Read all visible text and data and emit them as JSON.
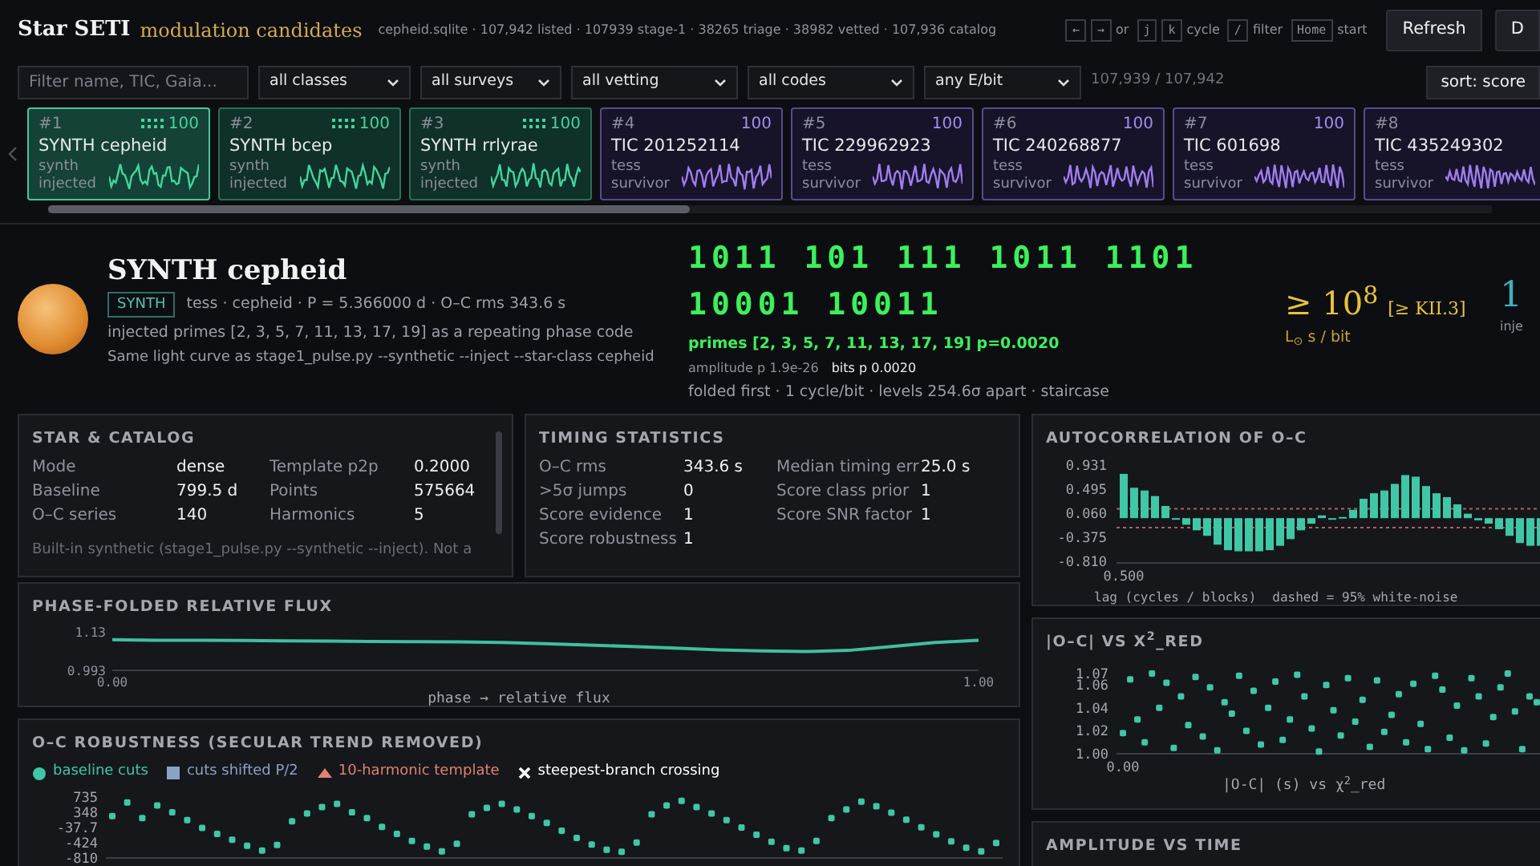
{
  "header": {
    "title": "Star SETI",
    "subtitle": "modulation candidates",
    "stats": "cepheid.sqlite · 107,942 listed · 107939 stage-1 · 38265 triage · 38982 vetted · 107,936 catalog",
    "shortcuts": [
      {
        "kind": "key",
        "text": "←"
      },
      {
        "kind": "key",
        "text": "→"
      },
      {
        "kind": "word",
        "text": "or"
      },
      {
        "kind": "key",
        "text": "j"
      },
      {
        "kind": "key",
        "text": "k"
      },
      {
        "kind": "word",
        "text": "cycle"
      },
      {
        "kind": "key",
        "text": "/"
      },
      {
        "kind": "word",
        "text": "filter"
      },
      {
        "kind": "key",
        "text": "Home"
      },
      {
        "kind": "word",
        "text": "start"
      }
    ],
    "buttons": [
      "Refresh",
      "D"
    ]
  },
  "filters": {
    "search": {
      "placeholder": "Filter name, TIC, Gaia..."
    },
    "selects": [
      "all classes",
      "all surveys",
      "all vetting",
      "all codes",
      "any E/bit"
    ],
    "count": "107,939 / 107,942",
    "sort": "sort: score"
  },
  "candidates": [
    {
      "kind": "synth",
      "number": "#1",
      "name": "SYNTH cepheid",
      "source": "synth",
      "status": "injected",
      "score": "100",
      "selected": true
    },
    {
      "kind": "synth",
      "number": "#2",
      "name": "SYNTH bcep",
      "source": "synth",
      "status": "injected",
      "score": "100",
      "selected": false
    },
    {
      "kind": "synth",
      "number": "#3",
      "name": "SYNTH rrlyrae",
      "source": "synth",
      "status": "injected",
      "score": "100",
      "selected": false
    },
    {
      "kind": "survey",
      "number": "#4",
      "name": "TIC 201252114",
      "source": "tess",
      "status": "survivor",
      "score": "100",
      "selected": false
    },
    {
      "kind": "survey",
      "number": "#5",
      "name": "TIC 229962923",
      "source": "tess",
      "status": "survivor",
      "score": "100",
      "selected": false
    },
    {
      "kind": "survey",
      "number": "#6",
      "name": "TIC 240268877",
      "source": "tess",
      "status": "survivor",
      "score": "100",
      "selected": false
    },
    {
      "kind": "survey",
      "number": "#7",
      "name": "TIC 601698",
      "source": "tess",
      "status": "survivor",
      "score": "100",
      "selected": false
    },
    {
      "kind": "survey",
      "number": "#8",
      "name": "TIC 435249302",
      "source": "tess",
      "status": "survivor",
      "selected": false
    }
  ],
  "star": {
    "name": "SYNTH cepheid",
    "badge": "SYNTH",
    "meta": "tess · cepheid · P = 5.366000 d · O–C rms 343.6 s",
    "note": "injected primes [2, 3, 5, 7, 11, 13, 17, 19] as a repeating phase code",
    "command": "Same light curve as stage1_pulse.py --synthetic --inject --star-class cepheid"
  },
  "code": {
    "bits": [
      "1011 101 111 1011 1101",
      "10001 10011"
    ],
    "primes": "primes [2, 3, 5, 7, 11, 13, 17, 19] p=0.0020",
    "amplitude_p": "amplitude p 1.9e-26",
    "bits_p": "bits p 0.0020",
    "detail": "folded first · 1 cycle/bit · levels 254.6σ apart · staircase"
  },
  "energy": {
    "value": "≥ 10$^{8}$",
    "class": "[≥ KII.3]",
    "unit": "L$_{⊙}$ s / bit"
  },
  "injected": {
    "value": "1",
    "label": "inje"
  },
  "star_catalog": {
    "title": "STAR & CATALOG",
    "rows": [
      [
        "Mode",
        "dense",
        "Template p2p",
        "0.2000"
      ],
      [
        "Baseline",
        "799.5 d",
        "Points",
        "575664"
      ],
      [
        "O–C series",
        "140",
        "Harmonics",
        "5"
      ]
    ],
    "note": "Built-in synthetic (stage1_pulse.py --synthetic --inject). Not a"
  },
  "timing": {
    "title": "TIMING STATISTICS",
    "rows": [
      [
        "O–C rms",
        "343.6 s",
        "Median timing err",
        "25.0 s"
      ],
      [
        ">5σ jumps",
        "0",
        "Score class prior",
        "1"
      ],
      [
        "Score evidence",
        "1",
        "Score SNR factor",
        "1"
      ],
      [
        "Score robustness",
        "1"
      ]
    ]
  },
  "flux": {
    "title": "PHASE-FOLDED RELATIVE FLUX",
    "chart_data": {
      "type": "line",
      "xlabel": "phase → relative flux",
      "x": [
        0,
        0.05,
        0.1,
        0.15,
        0.2,
        0.25,
        0.3,
        0.35,
        0.4,
        0.45,
        0.5,
        0.55,
        0.6,
        0.65,
        0.7,
        0.75,
        0.8,
        0.85,
        0.9,
        0.95,
        1
      ],
      "series": [
        {
          "color": "#3fbf9f",
          "values": [
            1.102,
            1.1,
            1.1,
            1.099,
            1.098,
            1.097,
            1.096,
            1.095,
            1.094,
            1.092,
            1.088,
            1.083,
            1.078,
            1.072,
            1.066,
            1.062,
            1.06,
            1.064,
            1.078,
            1.092,
            1.1
          ]
        }
      ],
      "xlim": [
        0,
        1
      ],
      "ylim": [
        0.993,
        1.13
      ],
      "xticks": [
        {
          "value": 0,
          "label": "0.00"
        },
        {
          "value": 1,
          "label": "1.00"
        }
      ],
      "yticks": [
        {
          "value": 0.993,
          "label": "0.993"
        },
        {
          "value": 1.13,
          "label": "1.13"
        }
      ]
    }
  },
  "autocorrelation": {
    "title": "AUTOCORRELATION OF O–C",
    "chart_data": {
      "type": "bar",
      "xlabel": "lag (cycles / blocks)",
      "annotations": [
        "dashed = 95% white-noise"
      ],
      "ref_lines": [
        {
          "axis": "y",
          "value": 0.17
        },
        {
          "axis": "y",
          "value": -0.17
        }
      ],
      "categories": [
        "0.500",
        null,
        null,
        null,
        null,
        null,
        null,
        null,
        null,
        null,
        null,
        null,
        null,
        null,
        null,
        null,
        null,
        null,
        null,
        null,
        null,
        null,
        null,
        null,
        null,
        null,
        null,
        null,
        null,
        null,
        null,
        null,
        null,
        null,
        null,
        null,
        null,
        null,
        null,
        null,
        null
      ],
      "series": [
        {
          "color": "#3fc7a6",
          "values": [
            0.8,
            0.55,
            0.5,
            0.4,
            0.22,
            -0.02,
            -0.12,
            -0.22,
            -0.32,
            -0.48,
            -0.58,
            -0.6,
            -0.6,
            -0.6,
            -0.58,
            -0.5,
            -0.38,
            -0.22,
            -0.1,
            0.05,
            -0.02,
            0.02,
            0.15,
            0.35,
            0.45,
            0.5,
            0.62,
            0.78,
            0.75,
            0.58,
            0.45,
            0.38,
            0.25,
            0.08,
            -0.04,
            -0.1,
            -0.2,
            -0.32,
            -0.45,
            -0.5,
            -0.5
          ]
        }
      ],
      "ylim": [
        -0.81,
        0.931
      ],
      "yticks": [
        {
          "value": 0.931,
          "label": "0.931"
        },
        {
          "value": 0.495,
          "label": "0.495"
        },
        {
          "value": 0.06,
          "label": "0.060"
        },
        {
          "value": -0.375,
          "label": "-0.375"
        },
        {
          "value": -0.81,
          "label": "-0.810"
        }
      ]
    }
  },
  "scatter": {
    "title": "|O–C| VS X$^{2}$_RED",
    "chart_data": {
      "type": "scatter",
      "xlabel": "|O-C| (s)  vs  χ$^{2}$_red",
      "categories": [
        "0.00",
        null,
        null,
        null,
        null,
        null,
        null,
        null,
        null,
        null,
        null,
        null,
        null,
        null,
        null,
        null,
        null,
        null,
        null,
        null,
        null,
        null,
        null,
        null,
        null,
        null,
        null,
        null,
        null,
        null,
        null,
        null,
        null,
        null,
        null,
        null,
        null,
        null,
        null,
        null,
        null,
        null,
        null,
        null,
        null,
        null,
        null,
        null,
        null,
        null,
        null,
        null,
        null,
        null,
        null,
        null,
        null,
        null
      ],
      "series": [
        {
          "color": "#3fc7a6",
          "values": [
            1.018,
            1.065,
            1.03,
            1.01,
            1.07,
            1.04,
            1.062,
            1.005,
            1.05,
            1.025,
            1.067,
            1.015,
            1.058,
            1.003,
            1.045,
            1.035,
            1.068,
            1.02,
            1.055,
            1.008,
            1.04,
            1.063,
            1.012,
            1.03,
            1.069,
            1.05,
            1.022,
            1.002,
            1.06,
            1.038,
            1.016,
            1.066,
            1.028,
            1.047,
            1.006,
            1.064,
            1.019,
            1.034,
            1.052,
            1.01,
            1.061,
            1.026,
            1.004,
            1.068,
            1.056,
            1.014,
            1.042,
            1.003,
            1.066,
            1.05,
            1.009,
            1.032,
            1.058,
            1.07,
            1.037,
            1.004,
            1.05,
            1.045
          ]
        }
      ],
      "ylim": [
        1.0,
        1.07
      ],
      "yticks": [
        {
          "value": 1.0,
          "label": "1.00"
        },
        {
          "value": 1.02,
          "label": "1.02"
        },
        {
          "value": 1.04,
          "label": "1.04"
        },
        {
          "value": 1.06,
          "label": "1.06"
        },
        {
          "value": 1.07,
          "label": "1.07"
        }
      ]
    }
  },
  "robustness": {
    "title": "O–C ROBUSTNESS (SECULAR TREND REMOVED)",
    "legend": [
      {
        "kind": "circle",
        "label": "baseline cuts",
        "color": "#3fc7a6"
      },
      {
        "kind": "square",
        "label": "cuts shifted P/2",
        "color": "#8aa2c4"
      },
      {
        "kind": "triangle",
        "label": "10-harmonic template",
        "color": "#e08070"
      },
      {
        "kind": "cross",
        "label": "steepest-branch crossing",
        "color": "#ffffff"
      }
    ],
    "chart_data": {
      "type": "scatter",
      "categories": [
        null,
        null,
        null,
        null,
        null,
        null,
        null,
        null,
        null,
        null,
        null,
        null,
        null,
        null,
        null,
        null,
        null,
        null,
        null,
        null,
        null,
        null,
        null,
        null,
        null,
        null,
        null,
        null,
        null,
        null,
        null,
        null,
        null,
        null,
        null,
        null,
        null,
        null,
        null,
        null,
        null,
        null,
        null,
        null,
        null,
        null,
        null,
        null,
        null,
        null,
        null,
        null,
        null,
        null,
        null,
        null,
        null,
        null,
        null,
        null
      ],
      "series": [
        {
          "color": "#3fc7a6",
          "values": [
            250,
            600,
            200,
            520,
            350,
            150,
            -50,
            -200,
            -350,
            -500,
            -620,
            -480,
            120,
            320,
            480,
            560,
            350,
            200,
            -20,
            -200,
            -380,
            -520,
            -640,
            -450,
            300,
            460,
            560,
            420,
            250,
            80,
            -120,
            -300,
            -470,
            -600,
            -650,
            -420,
            300,
            520,
            640,
            480,
            320,
            150,
            -40,
            -220,
            -400,
            -560,
            -620,
            -380,
            200,
            420,
            620,
            500,
            340,
            160,
            -30,
            -210,
            -390,
            -550,
            -640,
            -430
          ]
        }
      ],
      "ylim": [
        -810,
        735
      ],
      "yticks": [
        {
          "value": 735,
          "label": "735"
        },
        {
          "value": 348,
          "label": "348"
        },
        {
          "value": -37.7,
          "label": "-37.7"
        },
        {
          "value": -424,
          "label": "-424"
        },
        {
          "value": -810,
          "label": "-810"
        }
      ]
    }
  },
  "amplitude": {
    "title": "AMPLITUDE VS TIME"
  }
}
